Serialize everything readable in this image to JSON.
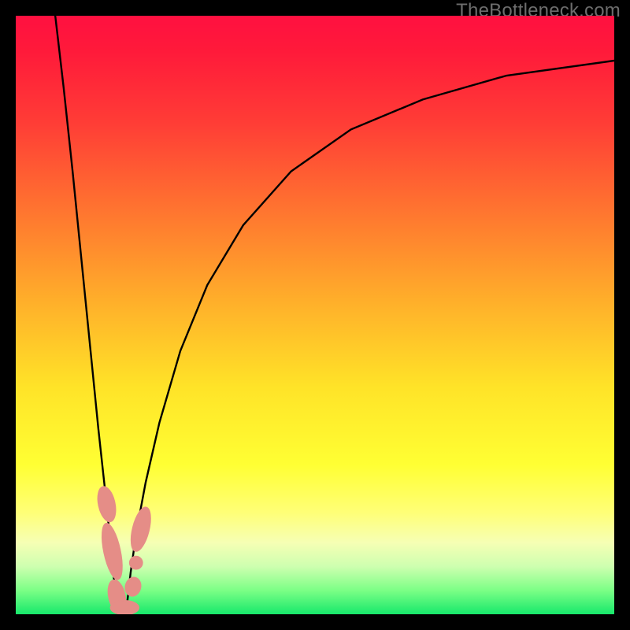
{
  "watermark": "TheBottleneck.com",
  "colors": {
    "frame": "#000000",
    "curve": "#000000",
    "marker": "#e58d87",
    "gradient_top": "#ff1040",
    "gradient_bottom": "#17e86b"
  },
  "chart_data": {
    "type": "line",
    "title": "",
    "xlabel": "",
    "ylabel": "",
    "xlim": [
      0,
      100
    ],
    "ylim": [
      0,
      100
    ],
    "grid": false,
    "legend": false,
    "annotations": [
      "TheBottleneck.com"
    ],
    "note": "Axes are unlabeled; values estimated from pixel positions (0,0 = bottom-left). y represents a percentage-style metric where lower is better (green region).",
    "series": [
      {
        "name": "left-branch",
        "x": [
          6.6,
          8.0,
          9.5,
          11.0,
          12.5,
          13.8,
          15.0,
          15.8,
          16.4,
          17.0
        ],
        "y": [
          100,
          88,
          74,
          59,
          44,
          31,
          20,
          12,
          6,
          0
        ]
      },
      {
        "name": "right-branch",
        "x": [
          18.4,
          19.2,
          20.2,
          21.7,
          24.0,
          27.5,
          32.0,
          38.0,
          46.0,
          56.0,
          68.0,
          82.0,
          100.0
        ],
        "y": [
          0,
          7,
          14,
          22,
          32,
          44,
          55,
          65,
          74,
          81,
          86,
          90,
          92.5
        ]
      }
    ],
    "markers": [
      {
        "name": "left-cluster-top",
        "cx": 15.2,
        "cy": 18.4,
        "rx": 1.4,
        "ry": 3.0,
        "rotate_deg": -12
      },
      {
        "name": "left-cluster-mid",
        "cx": 16.1,
        "cy": 10.5,
        "rx": 1.4,
        "ry": 4.8,
        "rotate_deg": -12
      },
      {
        "name": "left-cluster-low",
        "cx": 16.9,
        "cy": 3.0,
        "rx": 1.4,
        "ry": 2.8,
        "rotate_deg": -12
      },
      {
        "name": "bottom-pill",
        "cx": 18.2,
        "cy": 1.1,
        "rx": 2.4,
        "ry": 1.2,
        "rotate_deg": 0
      },
      {
        "name": "right-cluster-low",
        "cx": 19.6,
        "cy": 4.6,
        "rx": 1.3,
        "ry": 1.6,
        "rotate_deg": 14
      },
      {
        "name": "right-dot",
        "cx": 20.1,
        "cy": 8.6,
        "rx": 1.1,
        "ry": 1.1,
        "rotate_deg": 0
      },
      {
        "name": "right-cluster-top",
        "cx": 20.9,
        "cy": 14.2,
        "rx": 1.4,
        "ry": 3.8,
        "rotate_deg": 14
      }
    ]
  }
}
